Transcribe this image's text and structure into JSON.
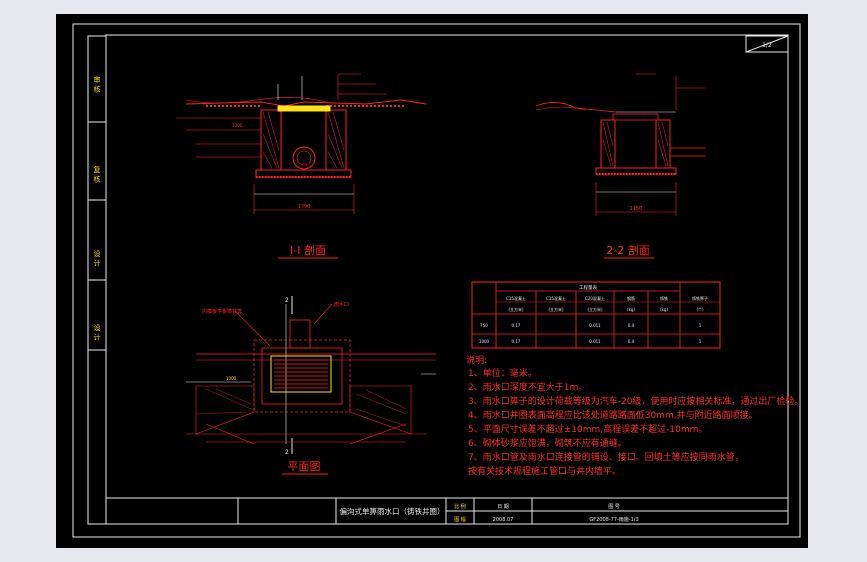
{
  "titles": {
    "section1": "I-I 剖面",
    "section2": "2-2 剖面",
    "plan": "平面图"
  },
  "sidebar": [
    "审 核",
    "复 核",
    "设 计",
    "设 计"
  ],
  "sheet_number": "1/2",
  "table": {
    "group_header": "工程量表",
    "columns": [
      "C15混凝土",
      "C15混凝土",
      "C20混凝土",
      "钢筋",
      "铸铁",
      "铸铁箅子"
    ],
    "units": [
      "(立方米)",
      "(立方米)",
      "(立方米)",
      "(kg)",
      "(kg)",
      "(个)"
    ],
    "rows": [
      {
        "label": "750",
        "cells": [
          "0.17",
          "",
          "0.011",
          "0.4",
          "",
          "1"
        ]
      },
      {
        "label": "1000",
        "cells": [
          "0.17",
          "",
          "0.011",
          "0.4",
          "",
          "1"
        ]
      }
    ]
  },
  "notes": {
    "heading": "说明:",
    "lines": [
      "1、单位：毫米。",
      "2、雨水口深度不宜大于1m。",
      "3、雨水口箅子的设计荷载等级为汽车-20级，使用时应按相关标准，通过出厂检验。",
      "4、雨水口井圈表面高程应比该处道路路面低30mm,并与附近路面顺接。",
      "5、平面尺寸误差不超过±10mm,高程误差不超过-10mm。",
      "6、砌体砂浆应饱满，砌筑不应有通缝。",
      "7、雨水口管及雨水口连接管的铺设、接口、回填土等应按同雨水管，",
      "   按有关技术规程施工管口与井内墙平。"
    ]
  },
  "callouts": {
    "plan_left": "内模板平板铸铁箅",
    "plan_right": "雨水口"
  },
  "title_block": {
    "drawing_name": "偏沟式单箅雨水口（铸铁井圈）",
    "role1": "比 例",
    "role2": "图 幅",
    "date_label": "日 期",
    "date": "2008.07",
    "number_label": "图 号",
    "number": "GF2008-77-雨施-1/3"
  },
  "dimensions": {
    "s1_width": "1790",
    "s1_left": "1000",
    "s2_width": "1150",
    "plan_left": "1000"
  },
  "colors": {
    "frame": "#e8e8e8",
    "drawing": "#ff2020",
    "accent": "#ffe21a",
    "pipe": "#19e6ff"
  }
}
